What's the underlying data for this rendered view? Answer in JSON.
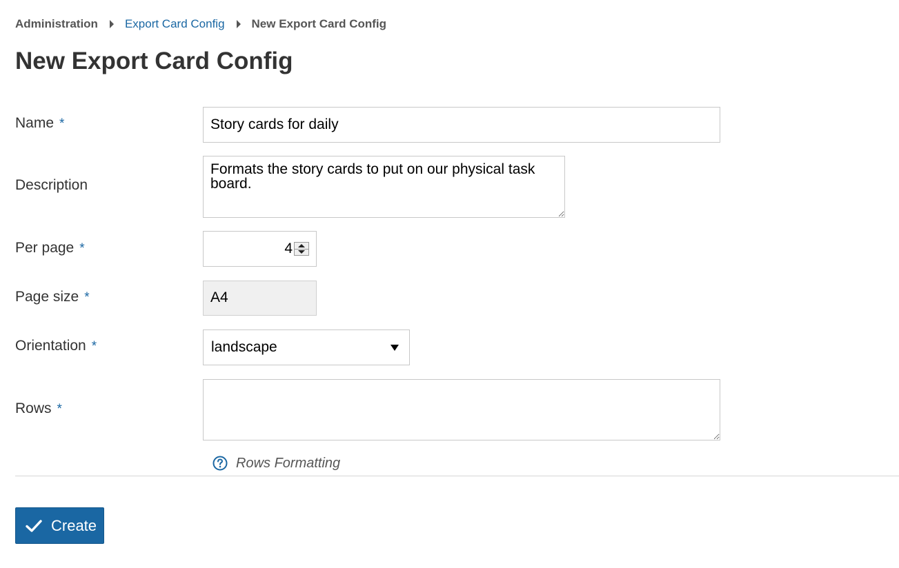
{
  "breadcrumb": {
    "root": "Administration",
    "parent": "Export Card Config",
    "current": "New Export Card Config"
  },
  "page": {
    "title": "New Export Card Config"
  },
  "form": {
    "required_marker": "*",
    "name": {
      "label": "Name",
      "value": "Story cards for daily"
    },
    "description": {
      "label": "Description",
      "value": "Formats the story cards to put on our physical task board."
    },
    "per_page": {
      "label": "Per page",
      "value": "4"
    },
    "page_size": {
      "label": "Page size",
      "value": "A4"
    },
    "orientation": {
      "label": "Orientation",
      "value": "landscape"
    },
    "rows": {
      "label": "Rows",
      "value": ""
    },
    "help_link": "Rows Formatting"
  },
  "actions": {
    "create_label": "Create"
  },
  "colors": {
    "primary": "#1a67a3",
    "text": "#333333",
    "readonly_bg": "#f0f0f0"
  },
  "icons": {
    "breadcrumb_separator": "caret-right-icon",
    "help": "question-circle-icon",
    "create": "checkmark-icon",
    "select": "dropdown-arrow-icon"
  }
}
